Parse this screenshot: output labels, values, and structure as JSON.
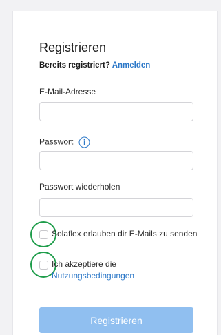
{
  "form": {
    "title": "Registrieren",
    "already_registered": "Bereits registriert?",
    "login_link": "Anmelden",
    "email_label": "E-Mail-Adresse",
    "email_value": "",
    "password_label": "Passwort",
    "password_value": "",
    "password_repeat_label": "Passwort wiederholen",
    "password_repeat_value": "",
    "consent_emails_text": "Solaflex erlauben dir E-Mails zu senden",
    "terms_text": "Ich akzeptiere die",
    "terms_link": "Nutzungsbedingungen",
    "submit_label": "Registrieren"
  },
  "icons": {
    "password_info": "info-icon",
    "checkbox_highlight": "green-circle-annotation"
  },
  "colors": {
    "link": "#2c78c8",
    "button": "#90bff0",
    "highlight": "#1f9d4b"
  }
}
